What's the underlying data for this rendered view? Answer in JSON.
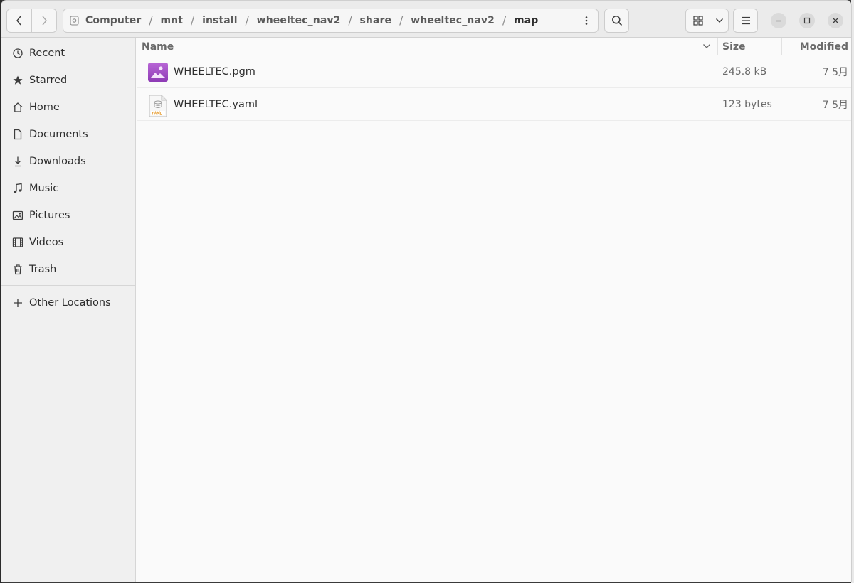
{
  "pathbar": {
    "crumbs": [
      "Computer",
      "mnt",
      "install",
      "wheeltec_nav2",
      "share",
      "wheeltec_nav2",
      "map"
    ],
    "separator": "/"
  },
  "sidebar": {
    "items": [
      {
        "label": "Recent",
        "icon": "clock-icon"
      },
      {
        "label": "Starred",
        "icon": "star-icon"
      },
      {
        "label": "Home",
        "icon": "home-icon"
      },
      {
        "label": "Documents",
        "icon": "document-icon"
      },
      {
        "label": "Downloads",
        "icon": "download-icon"
      },
      {
        "label": "Music",
        "icon": "music-icon"
      },
      {
        "label": "Pictures",
        "icon": "picture-icon"
      },
      {
        "label": "Videos",
        "icon": "video-icon"
      },
      {
        "label": "Trash",
        "icon": "trash-icon"
      }
    ],
    "other_locations": "Other Locations"
  },
  "columns": {
    "name": "Name",
    "size": "Size",
    "modified": "Modified"
  },
  "files": [
    {
      "name": "WHEELTEC.pgm",
      "size": "245.8 kB",
      "modified": "7 5月",
      "icon": "image-file-icon"
    },
    {
      "name": "WHEELTEC.yaml",
      "size": "123 bytes",
      "modified": "7 5月",
      "icon": "yaml-file-icon"
    }
  ],
  "colors": {
    "image_icon": "#a34fc4",
    "yaml_badge": "#e8a13a"
  }
}
